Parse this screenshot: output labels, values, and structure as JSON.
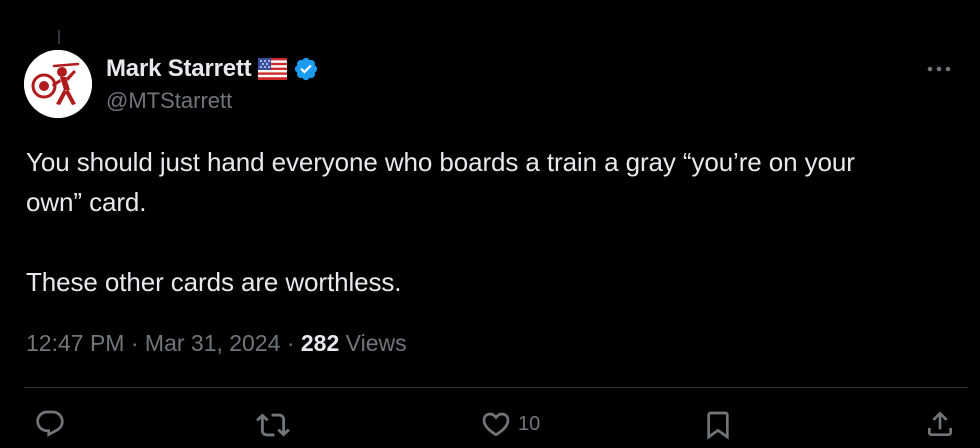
{
  "author": {
    "display_name": "Mark Starrett",
    "handle": "@MTStarrett",
    "flag_icon": "us-flag-icon",
    "verified_icon": "verified-badge-icon",
    "verified_color": "#1d9bf0"
  },
  "tweet": {
    "text_line1": "You should just hand everyone who boards a train a gray “you’re on your",
    "text_line2": "own” card.",
    "text_line3": "",
    "text_line4": "These other cards are worthless."
  },
  "meta": {
    "time": "12:47 PM",
    "separator": " · ",
    "date": "Mar 31, 2024",
    "views_count": "282",
    "views_label": " Views"
  },
  "actions": {
    "reply_icon": "reply-icon",
    "retweet_icon": "retweet-icon",
    "like_icon": "heart-icon",
    "like_count": "10",
    "bookmark_icon": "bookmark-icon",
    "share_icon": "share-icon"
  },
  "menu": {
    "more_icon": "more-options-icon"
  },
  "colors": {
    "background": "#000000",
    "text_primary": "#e7e9ea",
    "text_secondary": "#71767b",
    "divider": "#2f3336",
    "avatar_logo": "#b01c1c"
  }
}
